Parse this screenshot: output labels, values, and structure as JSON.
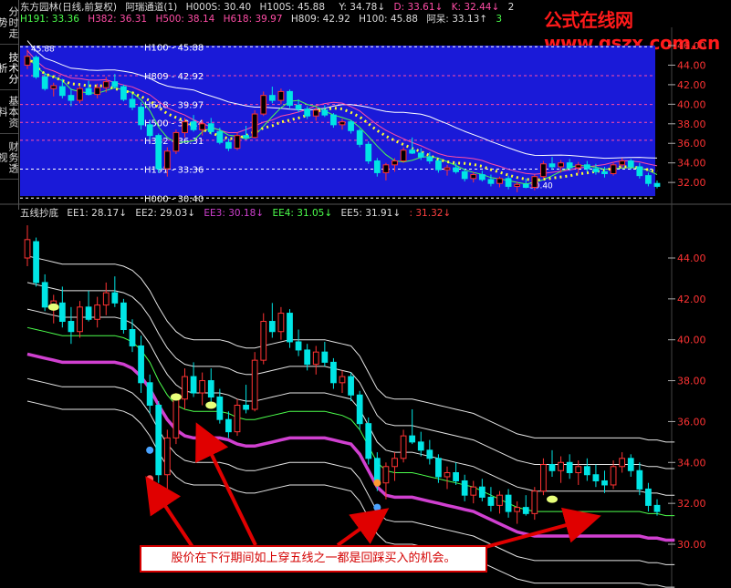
{
  "watermark": "公式在线网www.gszx.com.cn",
  "side_tabs": [
    "分时走势",
    "技术分析",
    "基本资料",
    "财务透视"
  ],
  "top_panel": {
    "row1": [
      {
        "text": "东方园林(日线,前复权)",
        "color": "#e0e0e0"
      },
      {
        "text": "阿瑞通道(1)",
        "color": "#e0e0e0"
      },
      {
        "text": "H000S: 30.40",
        "color": "#e0e0e0"
      },
      {
        "text": "H100S: 45.88",
        "color": "#e0e0e0"
      },
      {
        "text": "Y: 34.78↓",
        "color": "#e0e0e0"
      },
      {
        "text": "D: 33.61↓",
        "color": "#ff4da6"
      },
      {
        "text": "K: 32.44↓",
        "color": "#ff4da6"
      },
      {
        "text": "2",
        "color": "#e0e0e0"
      }
    ],
    "row2": [
      {
        "text": "H191: 33.36",
        "color": "#4cff4c"
      },
      {
        "text": "H382: 36.31",
        "color": "#ff4da6"
      },
      {
        "text": "H500: 38.14",
        "color": "#ff4da6"
      },
      {
        "text": "H618: 39.97",
        "color": "#ff4da6"
      },
      {
        "text": "H809: 42.92",
        "color": "#e0e0e0"
      },
      {
        "text": "H100: 45.88",
        "color": "#e0e0e0"
      },
      {
        "text": "阿呆: 33.13↑",
        "color": "#e0e0e0"
      },
      {
        "text": "3",
        "color": "#4cff4c"
      }
    ],
    "level_labels": [
      {
        "name": "H100",
        "text": "H100 - 45.88",
        "value": 45.88
      },
      {
        "name": "H809",
        "text": "H809 - 42.92",
        "value": 42.92
      },
      {
        "name": "H618",
        "text": "H618 - 39.97",
        "value": 39.97
      },
      {
        "name": "H500",
        "text": "H500 - 38.14",
        "value": 38.14
      },
      {
        "name": "H382",
        "text": "H382 - 36.31",
        "value": 36.31
      },
      {
        "name": "H191",
        "text": "H191 - 33.36",
        "value": 33.36
      },
      {
        "name": "H000",
        "text": "H000 - 30.40",
        "value": 30.4
      }
    ],
    "start_label": "45.88",
    "end_label": "30.40",
    "y_ticks": [
      "46.00",
      "44.00",
      "42.00",
      "40.00",
      "38.00",
      "36.00",
      "34.00",
      "32.00"
    ]
  },
  "bottom_panel": {
    "header": [
      {
        "text": "五线抄底",
        "color": "#e0e0e0"
      },
      {
        "text": "EE1: 28.17↓",
        "color": "#e0e0e0"
      },
      {
        "text": "EE2: 29.03↓",
        "color": "#e0e0e0"
      },
      {
        "text": "EE3: 30.18↓",
        "color": "#d040d0"
      },
      {
        "text": "EE4: 31.05↓",
        "color": "#4cff4c"
      },
      {
        "text": "EE5: 31.91↓",
        "color": "#e0e0e0"
      },
      {
        "text": ": 31.32↓",
        "color": "#ff4040"
      }
    ],
    "y_ticks": [
      "44.00",
      "42.00",
      "40.00",
      "38.00",
      "36.00",
      "34.00",
      "32.00",
      "30.00"
    ]
  },
  "callout_text": "股价在下行期间如上穿五线之一都是回踩买入的机会。",
  "chart_data": {
    "type": "candlestick",
    "symbol": "东方园林",
    "period": "日线",
    "adjustment": "前复权",
    "ylim": [
      29.4,
      46.6
    ],
    "candles": [
      {
        "o": 44.0,
        "h": 45.6,
        "l": 43.6,
        "c": 44.9
      },
      {
        "o": 44.8,
        "h": 45.0,
        "l": 42.6,
        "c": 42.8
      },
      {
        "o": 42.8,
        "h": 43.2,
        "l": 41.4,
        "c": 41.6
      },
      {
        "o": 41.6,
        "h": 42.2,
        "l": 40.8,
        "c": 41.9
      },
      {
        "o": 41.8,
        "h": 42.6,
        "l": 40.6,
        "c": 40.9
      },
      {
        "o": 40.9,
        "h": 41.6,
        "l": 39.8,
        "c": 40.4
      },
      {
        "o": 40.4,
        "h": 41.9,
        "l": 40.1,
        "c": 41.6
      },
      {
        "o": 41.6,
        "h": 42.4,
        "l": 40.9,
        "c": 41.0
      },
      {
        "o": 41.0,
        "h": 42.1,
        "l": 40.6,
        "c": 41.7
      },
      {
        "o": 41.7,
        "h": 42.8,
        "l": 41.2,
        "c": 42.3
      },
      {
        "o": 42.3,
        "h": 43.1,
        "l": 41.6,
        "c": 41.8
      },
      {
        "o": 41.8,
        "h": 42.0,
        "l": 40.3,
        "c": 40.5
      },
      {
        "o": 40.5,
        "h": 41.0,
        "l": 39.4,
        "c": 39.7
      },
      {
        "o": 39.7,
        "h": 40.2,
        "l": 37.4,
        "c": 37.9
      },
      {
        "o": 37.9,
        "h": 38.3,
        "l": 36.4,
        "c": 36.8
      },
      {
        "o": 36.8,
        "h": 37.0,
        "l": 33.0,
        "c": 33.4
      },
      {
        "o": 33.4,
        "h": 35.6,
        "l": 32.6,
        "c": 35.2
      },
      {
        "o": 35.2,
        "h": 37.4,
        "l": 34.9,
        "c": 37.1
      },
      {
        "o": 37.1,
        "h": 38.6,
        "l": 36.6,
        "c": 38.2
      },
      {
        "o": 38.2,
        "h": 38.9,
        "l": 37.2,
        "c": 37.4
      },
      {
        "o": 37.4,
        "h": 38.4,
        "l": 36.8,
        "c": 38.0
      },
      {
        "o": 38.0,
        "h": 38.6,
        "l": 36.9,
        "c": 37.2
      },
      {
        "o": 37.2,
        "h": 37.6,
        "l": 35.9,
        "c": 36.1
      },
      {
        "o": 36.1,
        "h": 36.5,
        "l": 35.2,
        "c": 35.5
      },
      {
        "o": 35.5,
        "h": 37.1,
        "l": 35.3,
        "c": 36.8
      },
      {
        "o": 36.8,
        "h": 37.8,
        "l": 36.4,
        "c": 36.6
      },
      {
        "o": 36.6,
        "h": 39.4,
        "l": 36.5,
        "c": 39.0
      },
      {
        "o": 39.0,
        "h": 41.3,
        "l": 38.8,
        "c": 40.9
      },
      {
        "o": 40.9,
        "h": 41.8,
        "l": 40.1,
        "c": 40.4
      },
      {
        "o": 40.4,
        "h": 41.6,
        "l": 40.0,
        "c": 41.3
      },
      {
        "o": 41.3,
        "h": 41.5,
        "l": 39.6,
        "c": 39.9
      },
      {
        "o": 39.9,
        "h": 40.5,
        "l": 39.2,
        "c": 39.5
      },
      {
        "o": 39.5,
        "h": 39.8,
        "l": 38.5,
        "c": 38.8
      },
      {
        "o": 38.8,
        "h": 39.7,
        "l": 38.3,
        "c": 39.4
      },
      {
        "o": 39.4,
        "h": 39.9,
        "l": 38.7,
        "c": 38.9
      },
      {
        "o": 38.9,
        "h": 39.1,
        "l": 37.6,
        "c": 37.9
      },
      {
        "o": 37.9,
        "h": 38.5,
        "l": 37.4,
        "c": 38.2
      },
      {
        "o": 38.2,
        "h": 38.4,
        "l": 37.0,
        "c": 37.3
      },
      {
        "o": 37.3,
        "h": 37.5,
        "l": 35.6,
        "c": 35.9
      },
      {
        "o": 35.9,
        "h": 36.2,
        "l": 33.9,
        "c": 34.2
      },
      {
        "o": 34.2,
        "h": 34.5,
        "l": 32.6,
        "c": 33.0
      },
      {
        "o": 33.0,
        "h": 34.0,
        "l": 32.2,
        "c": 33.8
      },
      {
        "o": 33.8,
        "h": 34.5,
        "l": 33.1,
        "c": 34.2
      },
      {
        "o": 34.2,
        "h": 35.6,
        "l": 34.0,
        "c": 35.3
      },
      {
        "o": 35.3,
        "h": 36.6,
        "l": 34.9,
        "c": 35.0
      },
      {
        "o": 35.0,
        "h": 35.5,
        "l": 34.3,
        "c": 34.6
      },
      {
        "o": 34.6,
        "h": 35.1,
        "l": 33.9,
        "c": 34.2
      },
      {
        "o": 34.2,
        "h": 34.4,
        "l": 33.0,
        "c": 33.3
      },
      {
        "o": 33.3,
        "h": 33.8,
        "l": 32.7,
        "c": 33.5
      },
      {
        "o": 33.5,
        "h": 34.0,
        "l": 32.9,
        "c": 33.1
      },
      {
        "o": 33.1,
        "h": 33.4,
        "l": 32.1,
        "c": 32.4
      },
      {
        "o": 32.4,
        "h": 33.1,
        "l": 32.0,
        "c": 32.8
      },
      {
        "o": 32.8,
        "h": 33.2,
        "l": 32.1,
        "c": 32.3
      },
      {
        "o": 32.3,
        "h": 32.8,
        "l": 31.6,
        "c": 31.9
      },
      {
        "o": 31.9,
        "h": 32.6,
        "l": 31.5,
        "c": 32.4
      },
      {
        "o": 32.4,
        "h": 32.7,
        "l": 31.3,
        "c": 31.6
      },
      {
        "o": 31.6,
        "h": 32.1,
        "l": 31.0,
        "c": 31.8
      },
      {
        "o": 31.8,
        "h": 32.4,
        "l": 31.4,
        "c": 31.5
      },
      {
        "o": 31.5,
        "h": 32.8,
        "l": 31.2,
        "c": 32.6
      },
      {
        "o": 32.6,
        "h": 34.2,
        "l": 32.4,
        "c": 33.9
      },
      {
        "o": 33.9,
        "h": 34.6,
        "l": 33.3,
        "c": 33.6
      },
      {
        "o": 33.6,
        "h": 34.3,
        "l": 33.0,
        "c": 34.0
      },
      {
        "o": 34.0,
        "h": 34.4,
        "l": 33.2,
        "c": 33.5
      },
      {
        "o": 33.5,
        "h": 34.1,
        "l": 32.9,
        "c": 33.8
      },
      {
        "o": 33.8,
        "h": 34.2,
        "l": 33.1,
        "c": 33.4
      },
      {
        "o": 33.4,
        "h": 33.9,
        "l": 32.8,
        "c": 33.1
      },
      {
        "o": 33.1,
        "h": 33.6,
        "l": 32.5,
        "c": 32.9
      },
      {
        "o": 32.9,
        "h": 34.1,
        "l": 32.7,
        "c": 33.8
      },
      {
        "o": 33.8,
        "h": 34.5,
        "l": 33.5,
        "c": 34.2
      },
      {
        "o": 34.2,
        "h": 34.4,
        "l": 33.3,
        "c": 33.6
      },
      {
        "o": 33.6,
        "h": 34.0,
        "l": 32.4,
        "c": 32.7
      },
      {
        "o": 32.7,
        "h": 33.0,
        "l": 31.6,
        "c": 31.9
      },
      {
        "o": 31.9,
        "h": 32.2,
        "l": 31.4,
        "c": 31.6
      }
    ],
    "series": [
      {
        "name": "EE3",
        "color": "#d040d0",
        "values": [
          39.3,
          39.2,
          39.1,
          39.0,
          38.9,
          38.9,
          38.9,
          38.9,
          38.9,
          38.9,
          38.9,
          38.8,
          38.6,
          38.2,
          37.6,
          36.8,
          36.1,
          35.6,
          35.3,
          35.2,
          35.2,
          35.2,
          35.2,
          35.1,
          34.9,
          34.8,
          34.8,
          34.9,
          35.0,
          35.1,
          35.2,
          35.2,
          35.2,
          35.2,
          35.2,
          35.1,
          35.0,
          34.9,
          34.4,
          33.6,
          32.8,
          32.4,
          32.3,
          32.3,
          32.3,
          32.2,
          32.1,
          32.0,
          31.9,
          31.8,
          31.7,
          31.6,
          31.4,
          31.2,
          31.0,
          30.8,
          30.6,
          30.5,
          30.4,
          30.4,
          30.4,
          30.4,
          30.4,
          30.4,
          30.4,
          30.4,
          30.4,
          30.4,
          30.4,
          30.4,
          30.4,
          30.3,
          30.3,
          30.2,
          30.2
        ]
      },
      {
        "name": "EE4",
        "color": "#4cff4c",
        "values": [
          40.6,
          40.5,
          40.4,
          40.3,
          40.2,
          40.2,
          40.2,
          40.2,
          40.2,
          40.2,
          40.2,
          40.1,
          39.9,
          39.5,
          38.9,
          38.0,
          37.3,
          36.8,
          36.6,
          36.5,
          36.5,
          36.5,
          36.5,
          36.4,
          36.2,
          36.1,
          36.1,
          36.2,
          36.3,
          36.4,
          36.5,
          36.5,
          36.5,
          36.5,
          36.5,
          36.4,
          36.3,
          36.1,
          35.6,
          34.8,
          34.0,
          33.6,
          33.5,
          33.5,
          33.5,
          33.4,
          33.3,
          33.2,
          33.1,
          33.0,
          32.9,
          32.8,
          32.6,
          32.4,
          32.2,
          32.0,
          31.8,
          31.7,
          31.6,
          31.6,
          31.6,
          31.6,
          31.6,
          31.6,
          31.6,
          31.6,
          31.6,
          31.6,
          31.6,
          31.6,
          31.6,
          31.5,
          31.5,
          31.4,
          31.4
        ]
      }
    ]
  }
}
